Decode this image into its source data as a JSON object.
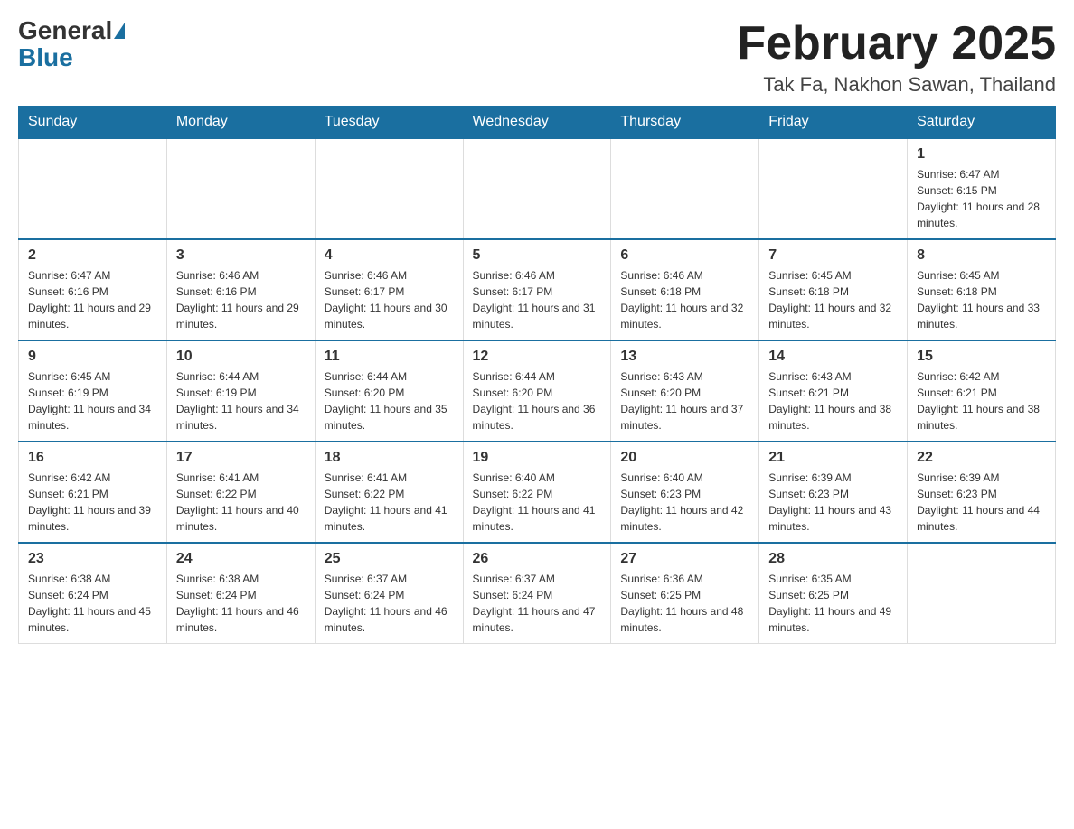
{
  "logo": {
    "general": "General",
    "blue": "Blue"
  },
  "title": "February 2025",
  "subtitle": "Tak Fa, Nakhon Sawan, Thailand",
  "days_of_week": [
    "Sunday",
    "Monday",
    "Tuesday",
    "Wednesday",
    "Thursday",
    "Friday",
    "Saturday"
  ],
  "weeks": [
    {
      "days": [
        {
          "number": "",
          "info": "",
          "empty": true
        },
        {
          "number": "",
          "info": "",
          "empty": true
        },
        {
          "number": "",
          "info": "",
          "empty": true
        },
        {
          "number": "",
          "info": "",
          "empty": true
        },
        {
          "number": "",
          "info": "",
          "empty": true
        },
        {
          "number": "",
          "info": "",
          "empty": true
        },
        {
          "number": "1",
          "info": "Sunrise: 6:47 AM\nSunset: 6:15 PM\nDaylight: 11 hours and 28 minutes.",
          "empty": false
        }
      ]
    },
    {
      "days": [
        {
          "number": "2",
          "info": "Sunrise: 6:47 AM\nSunset: 6:16 PM\nDaylight: 11 hours and 29 minutes.",
          "empty": false
        },
        {
          "number": "3",
          "info": "Sunrise: 6:46 AM\nSunset: 6:16 PM\nDaylight: 11 hours and 29 minutes.",
          "empty": false
        },
        {
          "number": "4",
          "info": "Sunrise: 6:46 AM\nSunset: 6:17 PM\nDaylight: 11 hours and 30 minutes.",
          "empty": false
        },
        {
          "number": "5",
          "info": "Sunrise: 6:46 AM\nSunset: 6:17 PM\nDaylight: 11 hours and 31 minutes.",
          "empty": false
        },
        {
          "number": "6",
          "info": "Sunrise: 6:46 AM\nSunset: 6:18 PM\nDaylight: 11 hours and 32 minutes.",
          "empty": false
        },
        {
          "number": "7",
          "info": "Sunrise: 6:45 AM\nSunset: 6:18 PM\nDaylight: 11 hours and 32 minutes.",
          "empty": false
        },
        {
          "number": "8",
          "info": "Sunrise: 6:45 AM\nSunset: 6:18 PM\nDaylight: 11 hours and 33 minutes.",
          "empty": false
        }
      ]
    },
    {
      "days": [
        {
          "number": "9",
          "info": "Sunrise: 6:45 AM\nSunset: 6:19 PM\nDaylight: 11 hours and 34 minutes.",
          "empty": false
        },
        {
          "number": "10",
          "info": "Sunrise: 6:44 AM\nSunset: 6:19 PM\nDaylight: 11 hours and 34 minutes.",
          "empty": false
        },
        {
          "number": "11",
          "info": "Sunrise: 6:44 AM\nSunset: 6:20 PM\nDaylight: 11 hours and 35 minutes.",
          "empty": false
        },
        {
          "number": "12",
          "info": "Sunrise: 6:44 AM\nSunset: 6:20 PM\nDaylight: 11 hours and 36 minutes.",
          "empty": false
        },
        {
          "number": "13",
          "info": "Sunrise: 6:43 AM\nSunset: 6:20 PM\nDaylight: 11 hours and 37 minutes.",
          "empty": false
        },
        {
          "number": "14",
          "info": "Sunrise: 6:43 AM\nSunset: 6:21 PM\nDaylight: 11 hours and 38 minutes.",
          "empty": false
        },
        {
          "number": "15",
          "info": "Sunrise: 6:42 AM\nSunset: 6:21 PM\nDaylight: 11 hours and 38 minutes.",
          "empty": false
        }
      ]
    },
    {
      "days": [
        {
          "number": "16",
          "info": "Sunrise: 6:42 AM\nSunset: 6:21 PM\nDaylight: 11 hours and 39 minutes.",
          "empty": false
        },
        {
          "number": "17",
          "info": "Sunrise: 6:41 AM\nSunset: 6:22 PM\nDaylight: 11 hours and 40 minutes.",
          "empty": false
        },
        {
          "number": "18",
          "info": "Sunrise: 6:41 AM\nSunset: 6:22 PM\nDaylight: 11 hours and 41 minutes.",
          "empty": false
        },
        {
          "number": "19",
          "info": "Sunrise: 6:40 AM\nSunset: 6:22 PM\nDaylight: 11 hours and 41 minutes.",
          "empty": false
        },
        {
          "number": "20",
          "info": "Sunrise: 6:40 AM\nSunset: 6:23 PM\nDaylight: 11 hours and 42 minutes.",
          "empty": false
        },
        {
          "number": "21",
          "info": "Sunrise: 6:39 AM\nSunset: 6:23 PM\nDaylight: 11 hours and 43 minutes.",
          "empty": false
        },
        {
          "number": "22",
          "info": "Sunrise: 6:39 AM\nSunset: 6:23 PM\nDaylight: 11 hours and 44 minutes.",
          "empty": false
        }
      ]
    },
    {
      "days": [
        {
          "number": "23",
          "info": "Sunrise: 6:38 AM\nSunset: 6:24 PM\nDaylight: 11 hours and 45 minutes.",
          "empty": false
        },
        {
          "number": "24",
          "info": "Sunrise: 6:38 AM\nSunset: 6:24 PM\nDaylight: 11 hours and 46 minutes.",
          "empty": false
        },
        {
          "number": "25",
          "info": "Sunrise: 6:37 AM\nSunset: 6:24 PM\nDaylight: 11 hours and 46 minutes.",
          "empty": false
        },
        {
          "number": "26",
          "info": "Sunrise: 6:37 AM\nSunset: 6:24 PM\nDaylight: 11 hours and 47 minutes.",
          "empty": false
        },
        {
          "number": "27",
          "info": "Sunrise: 6:36 AM\nSunset: 6:25 PM\nDaylight: 11 hours and 48 minutes.",
          "empty": false
        },
        {
          "number": "28",
          "info": "Sunrise: 6:35 AM\nSunset: 6:25 PM\nDaylight: 11 hours and 49 minutes.",
          "empty": false
        },
        {
          "number": "",
          "info": "",
          "empty": true
        }
      ]
    }
  ]
}
